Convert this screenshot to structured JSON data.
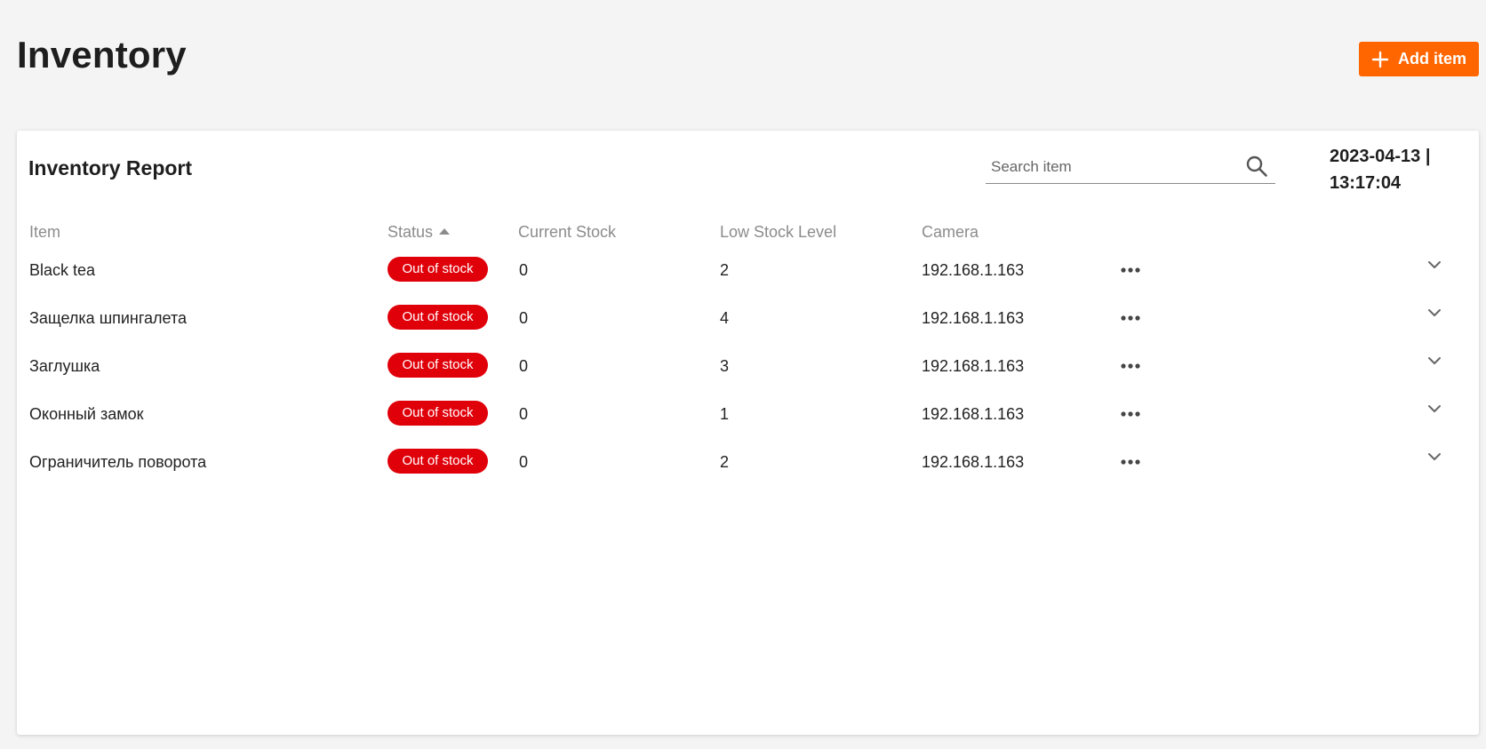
{
  "header": {
    "title": "Inventory",
    "add_button_label": "Add item"
  },
  "report": {
    "title": "Inventory Report",
    "search_placeholder": "Search item",
    "date": "2023-04-13 |",
    "time": "13:17:04"
  },
  "table": {
    "columns": {
      "item": "Item",
      "status": "Status",
      "current_stock": "Current Stock",
      "low_stock_level": "Low Stock Level",
      "camera": "Camera"
    },
    "sort": {
      "column": "status",
      "direction": "ascending"
    },
    "rows": [
      {
        "item": "Black tea",
        "status": "Out of stock",
        "current_stock": "0",
        "low_stock_level": "2",
        "camera": "192.168.1.163"
      },
      {
        "item": "Защелка шпингалета",
        "status": "Out of stock",
        "current_stock": "0",
        "low_stock_level": "4",
        "camera": "192.168.1.163"
      },
      {
        "item": "Заглушка",
        "status": "Out of stock",
        "current_stock": "0",
        "low_stock_level": "3",
        "camera": "192.168.1.163"
      },
      {
        "item": "Оконный замок",
        "status": "Out of stock",
        "current_stock": "0",
        "low_stock_level": "1",
        "camera": "192.168.1.163"
      },
      {
        "item": "Ограничитель поворота",
        "status": "Out of stock",
        "current_stock": "0",
        "low_stock_level": "2",
        "camera": "192.168.1.163"
      }
    ]
  },
  "icons": {
    "add": "plus-icon",
    "search": "search-icon",
    "sort": "sort-ascending-icon",
    "row_actions": "more-horizontal-icon",
    "row_expand": "chevron-down-icon"
  },
  "colors": {
    "accent": "#ff6600",
    "status_out_of_stock": "#e0000a",
    "page_background": "#f4f4f4",
    "header_text": "#8c8c8c"
  }
}
